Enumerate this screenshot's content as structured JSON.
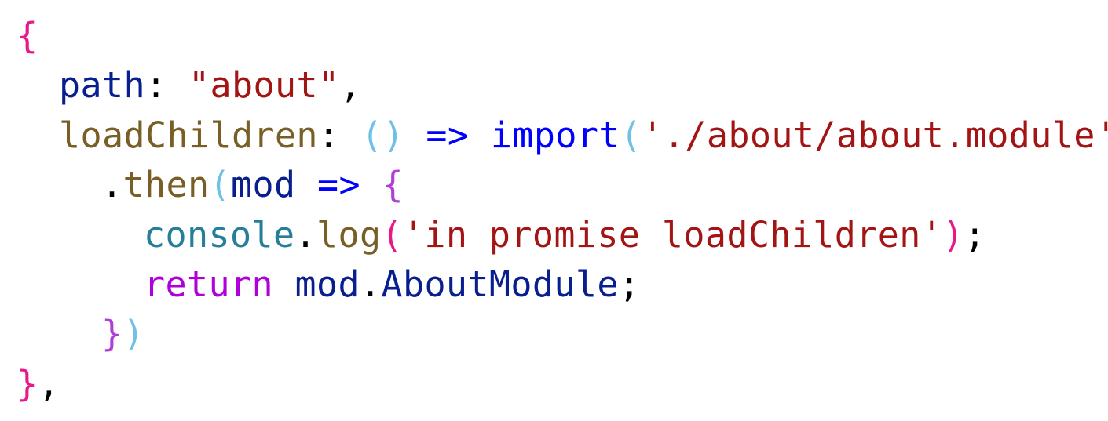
{
  "editor": {
    "lines": [
      {
        "indent": 0,
        "tokens": [
          {
            "text": "{",
            "color": "#e6188a"
          }
        ]
      },
      {
        "indent": 1,
        "tokens": [
          {
            "text": "path",
            "color": "#0a1f8f"
          },
          {
            "text": ": ",
            "color": "#000000"
          },
          {
            "text": "\"about\"",
            "color": "#a31515"
          },
          {
            "text": ",",
            "color": "#000000"
          }
        ]
      },
      {
        "indent": 1,
        "tokens": [
          {
            "text": "loadChildren",
            "color": "#795e26"
          },
          {
            "text": ": ",
            "color": "#000000"
          },
          {
            "text": "()",
            "color": "#6fc1e8"
          },
          {
            "text": " ",
            "color": "#000000"
          },
          {
            "text": "=>",
            "color": "#0000ff"
          },
          {
            "text": " ",
            "color": "#000000"
          },
          {
            "text": "import",
            "color": "#0000ff"
          },
          {
            "text": "(",
            "color": "#6fc1e8"
          },
          {
            "text": "'./about/about.module'",
            "color": "#a31515"
          },
          {
            "text": ")",
            "color": "#6fc1e8"
          }
        ]
      },
      {
        "indent": 2,
        "tokens": [
          {
            "text": ".",
            "color": "#000000"
          },
          {
            "text": "then",
            "color": "#795e26"
          },
          {
            "text": "(",
            "color": "#6fc1e8"
          },
          {
            "text": "mod",
            "color": "#0a1f8f"
          },
          {
            "text": " ",
            "color": "#000000"
          },
          {
            "text": "=>",
            "color": "#0000ff"
          },
          {
            "text": " ",
            "color": "#000000"
          },
          {
            "text": "{",
            "color": "#b03ed6"
          }
        ]
      },
      {
        "indent": 3,
        "tokens": [
          {
            "text": "console",
            "color": "#267f99"
          },
          {
            "text": ".",
            "color": "#000000"
          },
          {
            "text": "log",
            "color": "#795e26"
          },
          {
            "text": "(",
            "color": "#e6188a"
          },
          {
            "text": "'in promise loadChildren'",
            "color": "#a31515"
          },
          {
            "text": ")",
            "color": "#e6188a"
          },
          {
            "text": ";",
            "color": "#000000"
          }
        ]
      },
      {
        "indent": 3,
        "tokens": [
          {
            "text": "return",
            "color": "#af00db"
          },
          {
            "text": " ",
            "color": "#000000"
          },
          {
            "text": "mod",
            "color": "#0a1f8f"
          },
          {
            "text": ".",
            "color": "#000000"
          },
          {
            "text": "AboutModule",
            "color": "#0a1f8f"
          },
          {
            "text": ";",
            "color": "#000000"
          }
        ]
      },
      {
        "indent": 2,
        "tokens": [
          {
            "text": "}",
            "color": "#b03ed6"
          },
          {
            "text": ")",
            "color": "#6fc1e8"
          }
        ]
      },
      {
        "indent": 0,
        "tokens": [
          {
            "text": "}",
            "color": "#e6188a"
          },
          {
            "text": ",",
            "color": "#000000"
          }
        ]
      }
    ]
  }
}
